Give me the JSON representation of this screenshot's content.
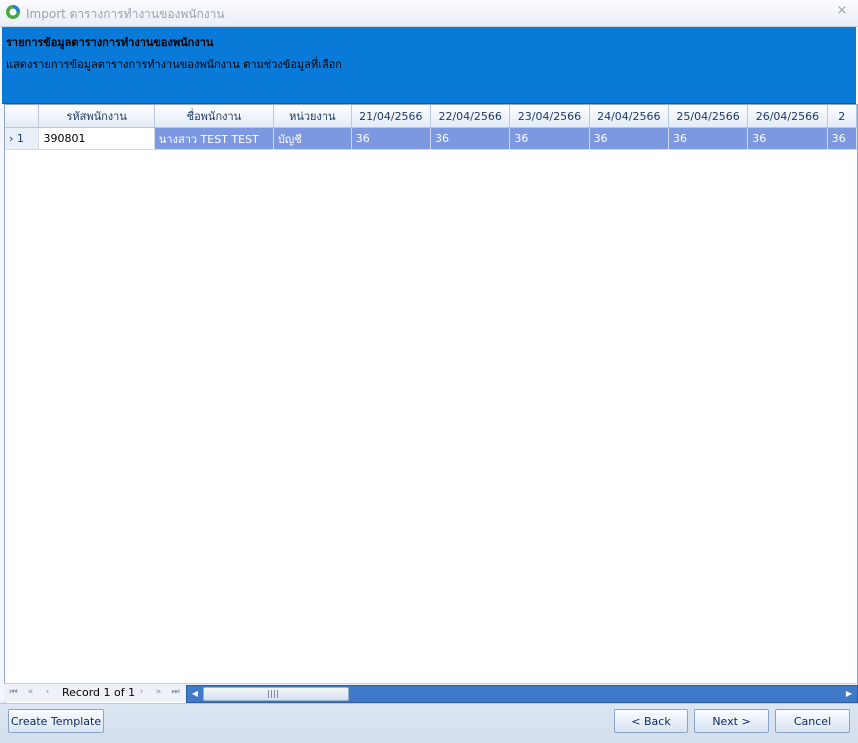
{
  "window": {
    "title": "Import ตารางการทำงานของพนักงาน",
    "close_glyph": "×",
    "icon": "app-logo-icon"
  },
  "banner": {
    "title": "รายการข้อมูลตารางการทำงานของพนักงาน",
    "description": "แสดงรายการข้อมูลตารางการทำงานของพนักงาน ตามช่วงข้อมูลที่เลือก",
    "color": "#0a7ad9"
  },
  "grid": {
    "columns": [
      "รหัสพนักงาน",
      "ชื่อพนักงาน",
      "หน่วยงาน",
      "21/04/2566",
      "22/04/2566",
      "23/04/2566",
      "24/04/2566",
      "25/04/2566",
      "26/04/2566",
      "2"
    ],
    "rows": [
      {
        "indicator": "›",
        "number": "1",
        "cells": [
          "390801",
          "นางสาว TEST TEST",
          "บัญชี",
          "36",
          "36",
          "36",
          "36",
          "36",
          "36",
          "36"
        ]
      }
    ],
    "selection_color": "#7b98e0"
  },
  "navigator": {
    "record_text": "Record 1 of 1",
    "first": "⏮",
    "prev_page": "«",
    "prev": "‹",
    "next": "›",
    "next_page": "»",
    "last": "⏭"
  },
  "footer": {
    "create_template": "Create Template",
    "back": "< Back",
    "next": "Next >",
    "cancel": "Cancel"
  }
}
